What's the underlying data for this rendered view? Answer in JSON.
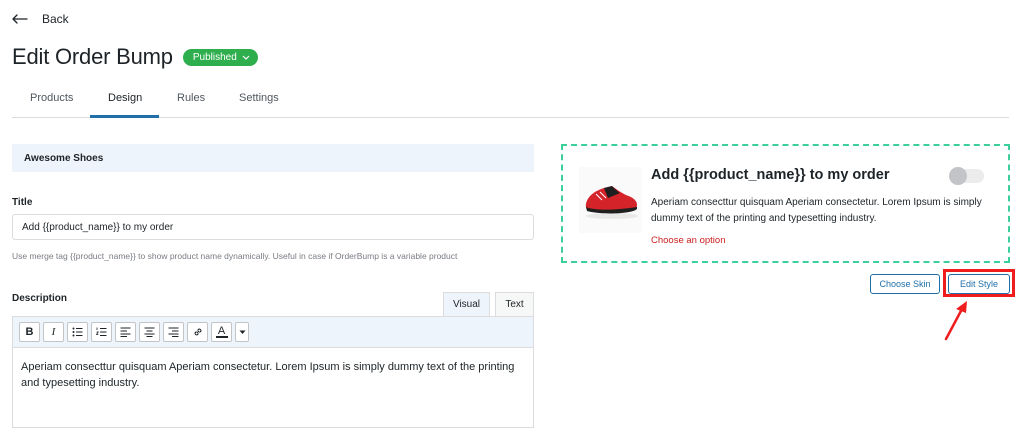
{
  "header": {
    "back_label": "Back",
    "page_title": "Edit Order Bump",
    "status": "Published"
  },
  "tabs": [
    {
      "label": "Products",
      "active": false
    },
    {
      "label": "Design",
      "active": true
    },
    {
      "label": "Rules",
      "active": false
    },
    {
      "label": "Settings",
      "active": false
    }
  ],
  "form": {
    "product_name": "Awesome Shoes",
    "title_label": "Title",
    "title_value": "Add {{product_name}} to my order",
    "title_help": "Use merge tag {{product_name}} to show product name dynamically. Useful in case if OrderBump is a variable product",
    "description_label": "Description",
    "editor_tabs": {
      "visual": "Visual",
      "text": "Text"
    },
    "toolbar_icons": [
      "bold-icon",
      "italic-icon",
      "bulleted-list-icon",
      "numbered-list-icon",
      "align-left-icon",
      "align-center-icon",
      "align-right-icon",
      "link-icon",
      "text-color-icon",
      "caret-down-icon"
    ],
    "toolbar_glyphs": {
      "bold": "B",
      "italic": "I",
      "text_color": "A"
    },
    "description_value": "Aperiam consecttur quisquam Aperiam consectetur. Lorem Ipsum is simply dummy text of the printing and typesetting industry."
  },
  "preview": {
    "title": "Add {{product_name}} to my order",
    "description": "Aperiam consecttur quisquam Aperiam consectetur. Lorem Ipsum is simply dummy text of the printing and typesetting industry.",
    "option_link": "Choose an option",
    "toggle_on": false,
    "image": "red-sneaker-image"
  },
  "buttons": {
    "choose_skin": "Choose Skin",
    "edit_style": "Edit Style"
  },
  "colors": {
    "accent": "#1f6fa8",
    "published": "#2fae4e",
    "preview_border": "#3ccf9a",
    "option_link": "#cc1f1f",
    "highlight": "#ef1d1d"
  }
}
